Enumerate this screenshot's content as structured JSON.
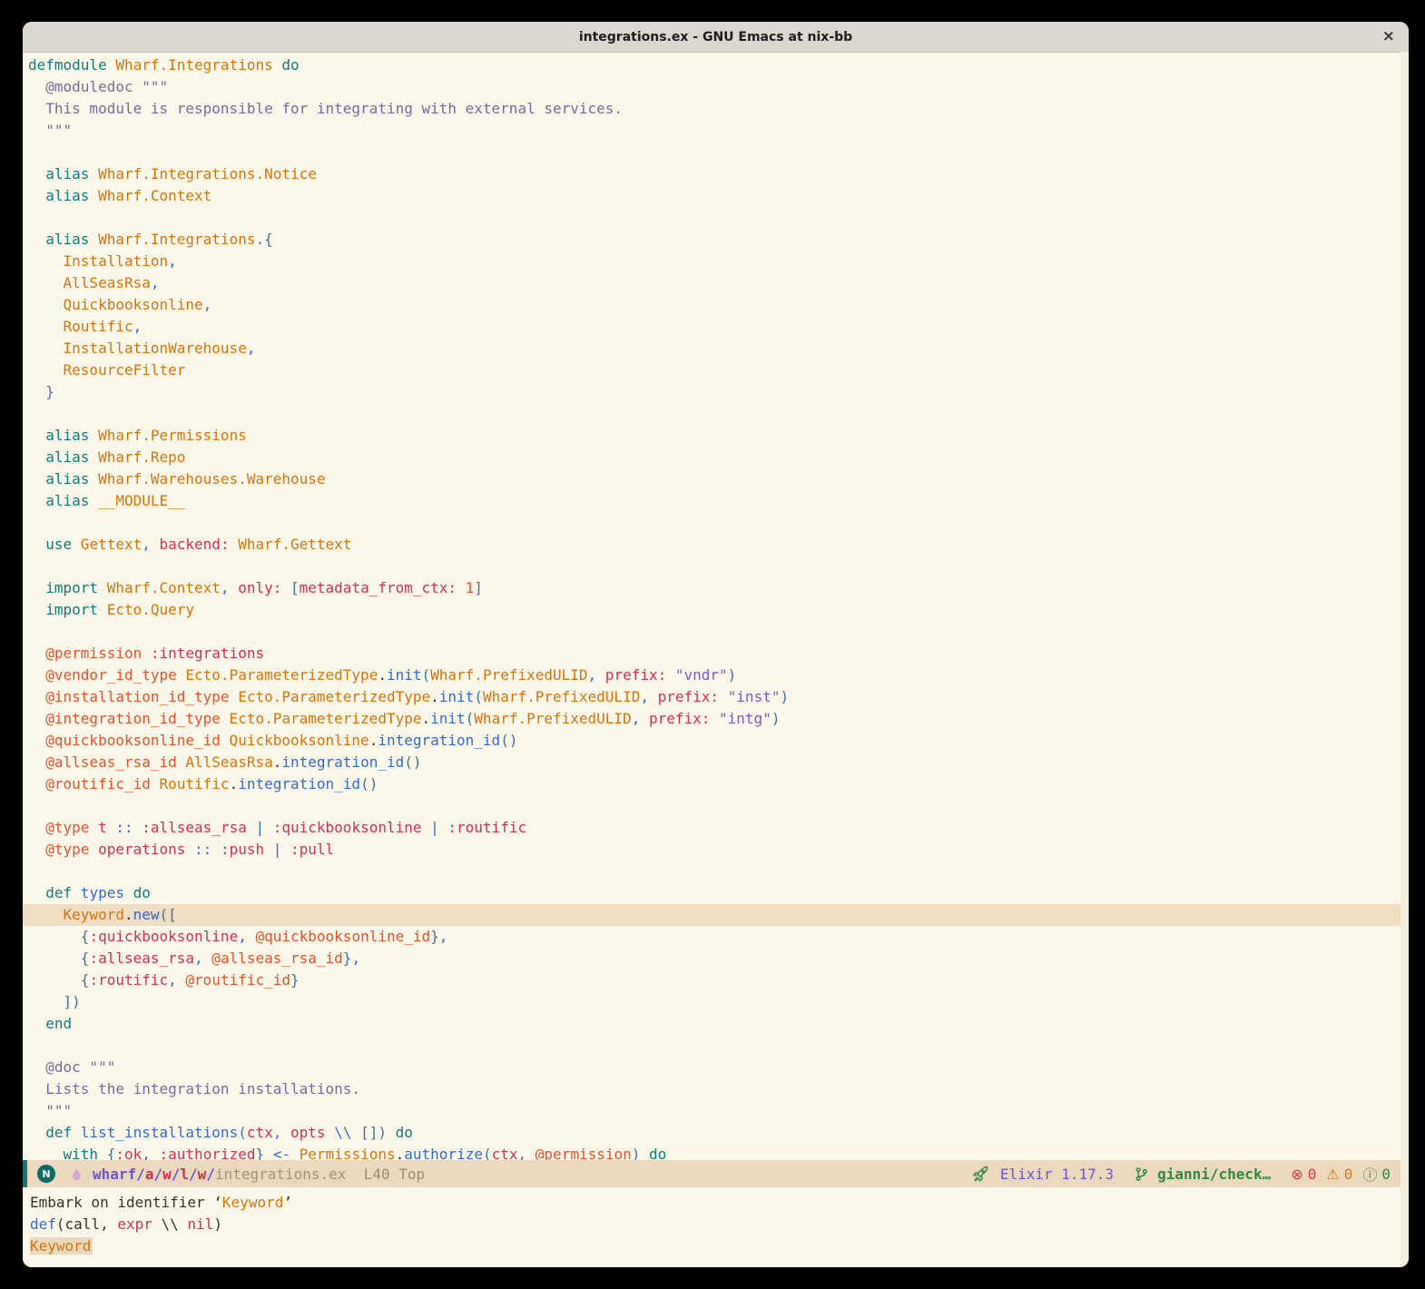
{
  "window": {
    "title": "integrations.ex - GNU Emacs at nix-bb",
    "close_label": "×"
  },
  "colors": {
    "bg": "#fcf8e9",
    "titlebar": "#dcd8d1",
    "titlefg": "#1d1d1d",
    "hl": "#f0ddc2",
    "mlbg": "#ecd8bd",
    "gutter": "#f5eedd",
    "kw": "#11797b",
    "mod": "#d4730c",
    "fn": "#3468cd",
    "punct": "#3468cd",
    "delim": "#41709b",
    "atom": "#d02f55",
    "attr": "#e4502b",
    "doc": "#79689f",
    "str": "#7a57d0",
    "num": "#e4502b",
    "plain": "#33322e",
    "echofg": "#26251f",
    "violet": "#6b53d6",
    "crimson": "#cf2d52",
    "mlfile": "#a29177",
    "mlinfo": "#9a8b79",
    "green": "#2e8b3d",
    "err": "#d8354a",
    "warn": "#cc7a1f",
    "info": "#2e8b3d",
    "badge": "#0c6b68",
    "droplet": "#d9a6dc"
  },
  "editor": {
    "lines": [
      {
        "s": [
          [
            "defmodule",
            "kw"
          ],
          [
            " Wharf.Integrations",
            "mod"
          ],
          [
            " do",
            "kw"
          ]
        ]
      },
      {
        "s": [
          [
            "  ",
            "plain"
          ],
          [
            "@moduledoc \"\"\"",
            "doc"
          ]
        ]
      },
      {
        "s": [
          [
            "  This module is responsible for integrating with external services.",
            "doc"
          ]
        ]
      },
      {
        "s": [
          [
            "  \"\"\"",
            "doc"
          ]
        ]
      },
      {
        "s": []
      },
      {
        "s": [
          [
            "  alias",
            "kw"
          ],
          [
            " Wharf.Integrations.Notice",
            "mod"
          ]
        ]
      },
      {
        "s": [
          [
            "  alias",
            "kw"
          ],
          [
            " Wharf.Context",
            "mod"
          ]
        ]
      },
      {
        "s": []
      },
      {
        "s": [
          [
            "  alias",
            "kw"
          ],
          [
            " Wharf.Integrations",
            "mod"
          ],
          [
            ".{",
            "delim"
          ]
        ]
      },
      {
        "s": [
          [
            "    Installation",
            "mod"
          ],
          [
            ",",
            "punct"
          ]
        ]
      },
      {
        "s": [
          [
            "    AllSeasRsa",
            "mod"
          ],
          [
            ",",
            "punct"
          ]
        ]
      },
      {
        "s": [
          [
            "    Quickbooksonline",
            "mod"
          ],
          [
            ",",
            "punct"
          ]
        ]
      },
      {
        "s": [
          [
            "    Routific",
            "mod"
          ],
          [
            ",",
            "punct"
          ]
        ]
      },
      {
        "s": [
          [
            "    InstallationWarehouse",
            "mod"
          ],
          [
            ",",
            "punct"
          ]
        ]
      },
      {
        "s": [
          [
            "    ResourceFilter",
            "mod"
          ]
        ]
      },
      {
        "s": [
          [
            "  }",
            "delim"
          ]
        ]
      },
      {
        "s": []
      },
      {
        "s": [
          [
            "  alias",
            "kw"
          ],
          [
            " Wharf.Permissions",
            "mod"
          ]
        ]
      },
      {
        "s": [
          [
            "  alias",
            "kw"
          ],
          [
            " Wharf.Repo",
            "mod"
          ]
        ]
      },
      {
        "s": [
          [
            "  alias",
            "kw"
          ],
          [
            " Wharf.Warehouses.Warehouse",
            "mod"
          ]
        ]
      },
      {
        "s": [
          [
            "  alias",
            "kw"
          ],
          [
            " __MODULE__",
            "mod"
          ]
        ]
      },
      {
        "s": []
      },
      {
        "s": [
          [
            "  use",
            "kw"
          ],
          [
            " Gettext",
            "mod"
          ],
          [
            ",",
            "punct"
          ],
          [
            " backend:",
            "atom"
          ],
          [
            " Wharf.Gettext",
            "mod"
          ]
        ]
      },
      {
        "s": []
      },
      {
        "s": [
          [
            "  import",
            "kw"
          ],
          [
            " Wharf.Context",
            "mod"
          ],
          [
            ",",
            "punct"
          ],
          [
            " only:",
            "atom"
          ],
          [
            " ",
            "plain"
          ],
          [
            "[",
            "delim"
          ],
          [
            "metadata_from_ctx:",
            "atom"
          ],
          [
            " 1",
            "num"
          ],
          [
            "]",
            "delim"
          ]
        ]
      },
      {
        "s": [
          [
            "  import",
            "kw"
          ],
          [
            " Ecto.Query",
            "mod"
          ]
        ]
      },
      {
        "s": []
      },
      {
        "s": [
          [
            "  @permission",
            "attr"
          ],
          [
            " :integrations",
            "atom"
          ]
        ]
      },
      {
        "s": [
          [
            "  @vendor_id_type",
            "attr"
          ],
          [
            " Ecto.ParameterizedType",
            "mod"
          ],
          [
            ".",
            "plain"
          ],
          [
            "init",
            "fn"
          ],
          [
            "(",
            "delim"
          ],
          [
            "Wharf.PrefixedULID",
            "mod"
          ],
          [
            ",",
            "punct"
          ],
          [
            " prefix:",
            "atom"
          ],
          [
            " \"vndr\"",
            "str"
          ],
          [
            ")",
            "delim"
          ]
        ]
      },
      {
        "s": [
          [
            "  @installation_id_type",
            "attr"
          ],
          [
            " Ecto.ParameterizedType",
            "mod"
          ],
          [
            ".",
            "plain"
          ],
          [
            "init",
            "fn"
          ],
          [
            "(",
            "delim"
          ],
          [
            "Wharf.PrefixedULID",
            "mod"
          ],
          [
            ",",
            "punct"
          ],
          [
            " prefix:",
            "atom"
          ],
          [
            " \"inst\"",
            "str"
          ],
          [
            ")",
            "delim"
          ]
        ]
      },
      {
        "s": [
          [
            "  @integration_id_type",
            "attr"
          ],
          [
            " Ecto.ParameterizedType",
            "mod"
          ],
          [
            ".",
            "plain"
          ],
          [
            "init",
            "fn"
          ],
          [
            "(",
            "delim"
          ],
          [
            "Wharf.PrefixedULID",
            "mod"
          ],
          [
            ",",
            "punct"
          ],
          [
            " prefix:",
            "atom"
          ],
          [
            " \"intg\"",
            "str"
          ],
          [
            ")",
            "delim"
          ]
        ]
      },
      {
        "s": [
          [
            "  @quickbooksonline_id",
            "attr"
          ],
          [
            " Quickbooksonline",
            "mod"
          ],
          [
            ".",
            "plain"
          ],
          [
            "integration_id",
            "fn"
          ],
          [
            "()",
            "delim"
          ]
        ]
      },
      {
        "s": [
          [
            "  @allseas_rsa_id",
            "attr"
          ],
          [
            " AllSeasRsa",
            "mod"
          ],
          [
            ".",
            "plain"
          ],
          [
            "integration_id",
            "fn"
          ],
          [
            "()",
            "delim"
          ]
        ]
      },
      {
        "s": [
          [
            "  @routific_id",
            "attr"
          ],
          [
            " Routific",
            "mod"
          ],
          [
            ".",
            "plain"
          ],
          [
            "integration_id",
            "fn"
          ],
          [
            "()",
            "delim"
          ]
        ]
      },
      {
        "s": []
      },
      {
        "s": [
          [
            "  @type",
            "attr"
          ],
          [
            " t",
            "atom"
          ],
          [
            " ::",
            "punct"
          ],
          [
            " :allseas_rsa",
            "atom"
          ],
          [
            " |",
            "punct"
          ],
          [
            " :quickbooksonline",
            "atom"
          ],
          [
            " |",
            "punct"
          ],
          [
            " :routific",
            "atom"
          ]
        ]
      },
      {
        "s": [
          [
            "  @type",
            "attr"
          ],
          [
            " operations",
            "atom"
          ],
          [
            " ::",
            "punct"
          ],
          [
            " :push",
            "atom"
          ],
          [
            " |",
            "punct"
          ],
          [
            " :pull",
            "atom"
          ]
        ]
      },
      {
        "s": []
      },
      {
        "s": [
          [
            "  def",
            "kw"
          ],
          [
            " types",
            "fn"
          ],
          [
            " do",
            "kw"
          ]
        ]
      },
      {
        "hl": true,
        "s": [
          [
            "    Keyword",
            "mod"
          ],
          [
            ".",
            "plain"
          ],
          [
            "new",
            "fn"
          ],
          [
            "([",
            "delim"
          ]
        ]
      },
      {
        "s": [
          [
            "      {",
            "delim"
          ],
          [
            ":quickbooksonline",
            "atom"
          ],
          [
            ",",
            "punct"
          ],
          [
            " @quickbooksonline_id",
            "attr"
          ],
          [
            "}",
            "delim"
          ],
          [
            ",",
            "punct"
          ]
        ]
      },
      {
        "s": [
          [
            "      {",
            "delim"
          ],
          [
            ":allseas_rsa",
            "atom"
          ],
          [
            ",",
            "punct"
          ],
          [
            " @allseas_rsa_id",
            "attr"
          ],
          [
            "}",
            "delim"
          ],
          [
            ",",
            "punct"
          ]
        ]
      },
      {
        "s": [
          [
            "      {",
            "delim"
          ],
          [
            ":routific",
            "atom"
          ],
          [
            ",",
            "punct"
          ],
          [
            " @routific_id",
            "attr"
          ],
          [
            "}",
            "delim"
          ]
        ]
      },
      {
        "s": [
          [
            "    ])",
            "delim"
          ]
        ]
      },
      {
        "s": [
          [
            "  end",
            "kw"
          ]
        ]
      },
      {
        "s": []
      },
      {
        "s": [
          [
            "  ",
            "plain"
          ],
          [
            "@doc \"\"\"",
            "doc"
          ]
        ]
      },
      {
        "s": [
          [
            "  Lists the integration installations.",
            "doc"
          ]
        ]
      },
      {
        "s": [
          [
            "  \"\"\"",
            "doc"
          ]
        ]
      },
      {
        "s": [
          [
            "  def",
            "kw"
          ],
          [
            " list_installations",
            "fn"
          ],
          [
            "(",
            "delim"
          ],
          [
            "ctx",
            "atom"
          ],
          [
            ",",
            "punct"
          ],
          [
            " opts",
            "atom"
          ],
          [
            " \\\\",
            "punct"
          ],
          [
            " ",
            "plain"
          ],
          [
            "[]",
            "delim"
          ],
          [
            ")",
            "delim"
          ],
          [
            " do",
            "kw"
          ]
        ]
      },
      {
        "s": [
          [
            "    with",
            "kw"
          ],
          [
            " ",
            "plain"
          ],
          [
            "{",
            "delim"
          ],
          [
            ":ok",
            "atom"
          ],
          [
            ",",
            "punct"
          ],
          [
            " :authorized",
            "atom"
          ],
          [
            "}",
            "delim"
          ],
          [
            " <-",
            "punct"
          ],
          [
            " Permissions",
            "mod"
          ],
          [
            ".",
            "plain"
          ],
          [
            "authorize",
            "fn"
          ],
          [
            "(",
            "delim"
          ],
          [
            "ctx",
            "atom"
          ],
          [
            ",",
            "punct"
          ],
          [
            " @permission",
            "attr"
          ],
          [
            ")",
            "delim"
          ],
          [
            " do",
            "kw"
          ]
        ]
      }
    ]
  },
  "modeline": {
    "state_indicator": "N",
    "path_segments": [
      [
        "wharf",
        "violet"
      ],
      [
        "/",
        "violet"
      ],
      [
        "a",
        "crimson"
      ],
      [
        "/",
        "violet"
      ],
      [
        "w",
        "crimson"
      ],
      [
        "/",
        "violet"
      ],
      [
        "l",
        "crimson"
      ],
      [
        "/",
        "violet"
      ],
      [
        "w",
        "crimson"
      ],
      [
        "/",
        "violet"
      ]
    ],
    "filename": "integrations.ex",
    "line_info": "L40",
    "position": "Top",
    "lang": "Elixir 1.17.3",
    "branch": "gianni/check…",
    "error_glyph": "⊗",
    "warning_glyph": "⚠",
    "info_glyph": "ⓘ",
    "error_count": "0",
    "warning_count": "0",
    "info_count": "0"
  },
  "echo": {
    "lines": [
      {
        "s": [
          [
            "Embark on identifier ‘",
            "plain"
          ],
          [
            "Keyword",
            "mod"
          ],
          [
            "’",
            "plain"
          ]
        ]
      },
      {
        "s": [
          [
            "def",
            "fn"
          ],
          [
            "(call, ",
            "plain"
          ],
          [
            "expr",
            "atom"
          ],
          [
            " \\\\ ",
            "plain"
          ],
          [
            "nil",
            "atom"
          ],
          [
            ")",
            "plain"
          ]
        ]
      },
      {
        "hl": true,
        "s": [
          [
            "Keyword",
            "mod"
          ]
        ]
      }
    ]
  }
}
